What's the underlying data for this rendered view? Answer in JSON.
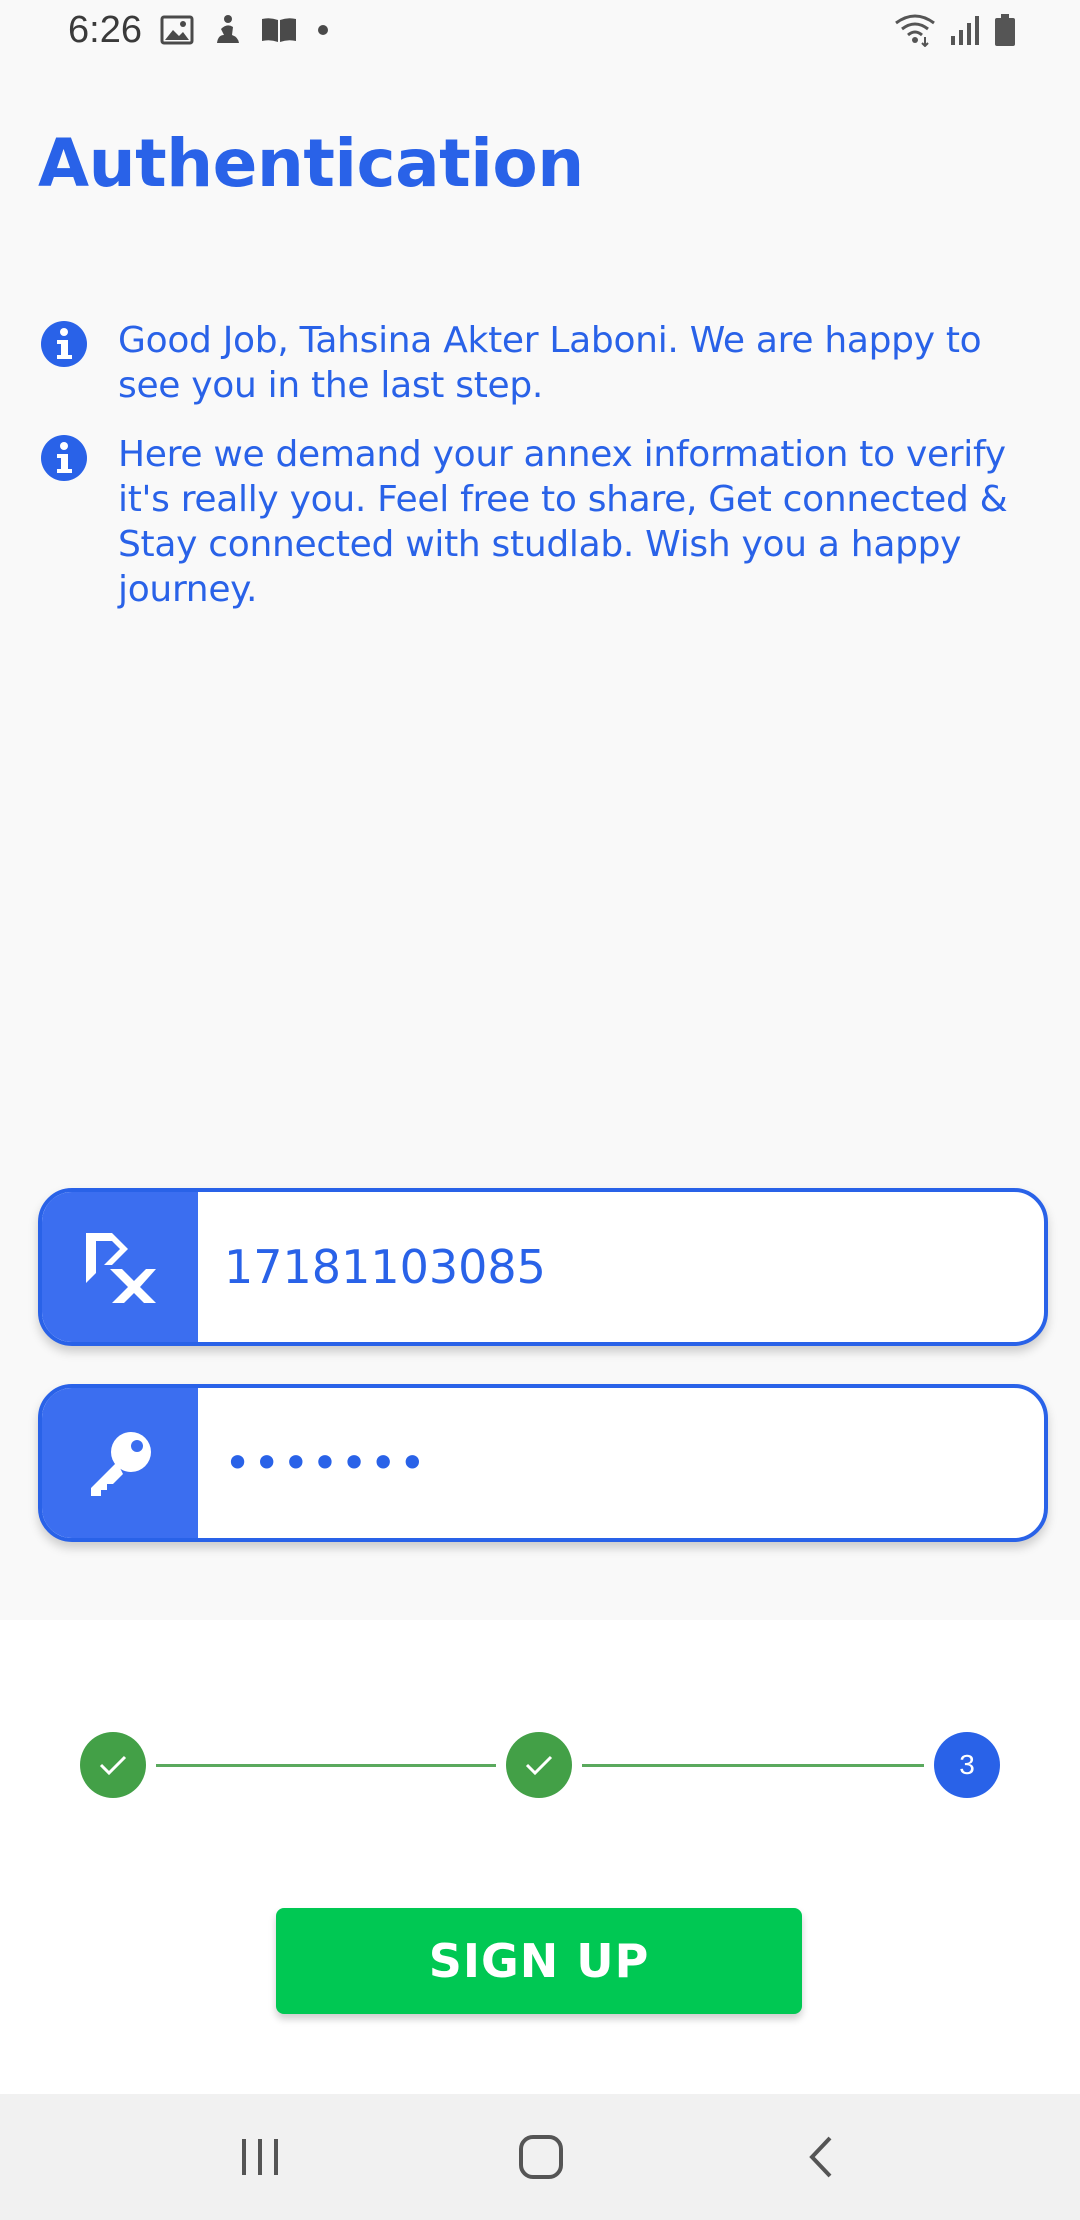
{
  "status_bar": {
    "time": "6:26",
    "left_icons": [
      "image-icon",
      "figure-icon",
      "book-icon",
      "dot-icon"
    ],
    "right_icons": [
      "wifi-icon",
      "signal-icon",
      "battery-icon"
    ]
  },
  "page": {
    "title": "Authentication"
  },
  "info": [
    {
      "icon": "info-icon",
      "text": "Good Job, Tahsina Akter Laboni. We are happy to see you in the last step."
    },
    {
      "icon": "info-icon",
      "text": "Here we demand your annex information to verify it's really you. Feel free to share, Get connected & Stay connected with studlab. Wish you a happy journey."
    }
  ],
  "form": {
    "id_field": {
      "icon": "studlab-logo-icon",
      "value": "17181103085"
    },
    "password_field": {
      "icon": "key-icon",
      "value": "•••••••"
    }
  },
  "stepper": {
    "steps": [
      {
        "state": "done",
        "label": "✓"
      },
      {
        "state": "done",
        "label": "✓"
      },
      {
        "state": "current",
        "label": "3"
      }
    ]
  },
  "actions": {
    "signup_label": "SIGN UP"
  },
  "nav": {
    "icons": [
      "recent-apps-icon",
      "home-icon",
      "back-icon"
    ]
  },
  "colors": {
    "primary": "#2962e8",
    "icon_box": "#3b6ef0",
    "success": "#43a047",
    "signup": "#00c853"
  }
}
